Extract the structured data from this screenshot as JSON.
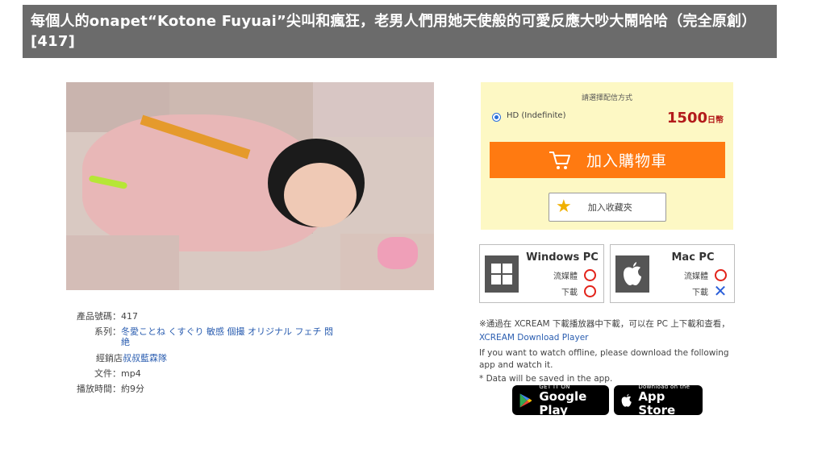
{
  "header": {
    "title": "每個人的onapet“Kotone Fuyuai”尖叫和瘋狂，老男人們用她天使般的可愛反應大吵大鬧哈哈（完全原創） [417]"
  },
  "product_image": {
    "icon": "product-photo"
  },
  "details": {
    "rows": [
      {
        "label": "產品號碼：",
        "value": "417"
      },
      {
        "label": "系列：",
        "value": "冬愛ことね くすぐり 敏感 個撮 オリジナル フェチ 悶絶"
      },
      {
        "label": "經銷店",
        "value": "叔叔藍霖隊"
      },
      {
        "label": "文件：",
        "value": "mp4"
      },
      {
        "label": "播放時間：",
        "value": "約9分"
      }
    ]
  },
  "purchase": {
    "caption": "請選擇配信方式",
    "option_label": "HD (Indefinite)",
    "price_value": "1500",
    "price_unit": "日幣",
    "cart_label": "加入購物車",
    "favorite_label": "加入收藏夾",
    "accent_color": "#ff7a11",
    "price_color": "#b31b1b"
  },
  "platforms": {
    "windows": {
      "name": "Windows PC",
      "stream_label": "流媒體",
      "download_label": "下載",
      "stream_ok": true,
      "download_ok": true
    },
    "mac": {
      "name": "Mac PC",
      "stream_label": "流媒體",
      "download_label": "下載",
      "stream_ok": true,
      "download_ok": false
    }
  },
  "note": {
    "line1": "※通過在 XCREAM 下載播放器中下載，可以在 PC 上下載和查看，",
    "link": "XCREAM Download Player",
    "line2": "If you want to watch offline, please download the following app and watch it.",
    "line3": "* Data will be saved in the app."
  },
  "stores": {
    "google": {
      "small": "GET IT ON",
      "big": "Google Play"
    },
    "apple": {
      "small": "Download on the",
      "big": "App Store"
    }
  }
}
